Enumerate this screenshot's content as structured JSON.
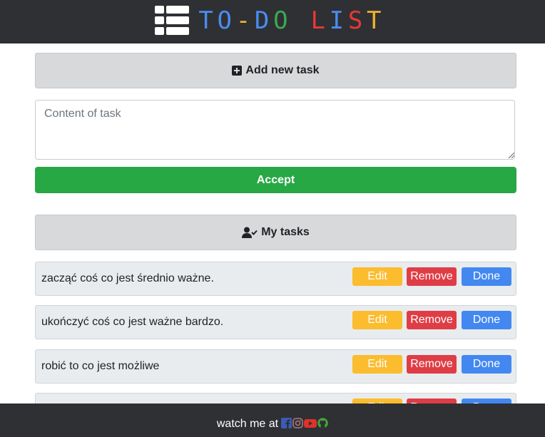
{
  "header": {
    "title_chars": [
      {
        "ch": "T",
        "color": "#4a8cf0"
      },
      {
        "ch": "O",
        "color": "#4a8cf0"
      },
      {
        "ch": "-",
        "color": "#f2b12b"
      },
      {
        "ch": "D",
        "color": "#4a8cf0"
      },
      {
        "ch": "O",
        "color": "#3aa94d"
      },
      {
        "ch": " ",
        "color": "#ffffff"
      },
      {
        "ch": "L",
        "color": "#e53935"
      },
      {
        "ch": "I",
        "color": "#4a8cf0"
      },
      {
        "ch": "S",
        "color": "#e53935"
      },
      {
        "ch": "T",
        "color": "#f2b12b"
      }
    ],
    "logo_icon": "list-icon"
  },
  "add_section": {
    "header_label": "Add new task",
    "header_icon": "plus-square-icon",
    "input_placeholder": "Content of task",
    "input_value": "",
    "accept_label": "Accept"
  },
  "tasks_section": {
    "header_label": "My tasks",
    "header_icon": "user-check-icon",
    "items": [
      {
        "text": "zacząć coś co jest średnio ważne.",
        "edit": "Edit",
        "remove": "Remove",
        "done": "Done"
      },
      {
        "text": "ukończyć coś co jest ważne bardzo.",
        "edit": "Edit",
        "remove": "Remove",
        "done": "Done"
      },
      {
        "text": "robić to co jest możliwe",
        "edit": "Edit",
        "remove": "Remove",
        "done": "Done"
      },
      {
        "text": "",
        "edit": "Edit",
        "remove": "Remove",
        "done": "Done"
      }
    ]
  },
  "footer": {
    "label": "watch me at",
    "social_icons": [
      "facebook-icon",
      "instagram-icon",
      "youtube-icon",
      "github-icon"
    ]
  },
  "colors": {
    "header_bg": "#2e3034",
    "accept": "#28a745",
    "edit": "#fbbc2e",
    "remove": "#df3d46",
    "done": "#4388f1"
  }
}
